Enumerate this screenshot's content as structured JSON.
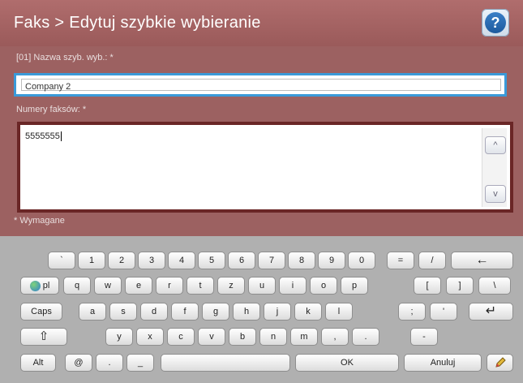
{
  "header": {
    "title": "Faks > Edytuj szybkie wybieranie",
    "help_icon": "question-mark-icon",
    "help_label": "?"
  },
  "form": {
    "name_label": "[01] Nazwa szyb. wyb.: *",
    "name_value": "Company 2",
    "fax_label": "Numery faksów: *",
    "fax_value": "5555555",
    "required_note": "* Wymagane",
    "scroll_up": "^",
    "scroll_down": "v"
  },
  "keyboard": {
    "row1": [
      "`",
      "1",
      "2",
      "3",
      "4",
      "5",
      "6",
      "7",
      "8",
      "9",
      "0",
      "=",
      "/"
    ],
    "backspace": "←",
    "lang": "pl",
    "row2": [
      "q",
      "w",
      "e",
      "r",
      "t",
      "z",
      "u",
      "i",
      "o",
      "p",
      "[",
      "]",
      "\\"
    ],
    "caps": "Caps",
    "row3": [
      "a",
      "s",
      "d",
      "f",
      "g",
      "h",
      "j",
      "k",
      "l",
      ";",
      "'"
    ],
    "enter": "↵",
    "shift": "⇧",
    "row4": [
      "y",
      "x",
      "c",
      "v",
      "b",
      "n",
      "m",
      ",",
      ".",
      "-"
    ],
    "alt": "Alt",
    "at": "@",
    "dot": ".",
    "underscore": "_",
    "space": "",
    "ok": "OK",
    "cancel": "Anuluj",
    "edit_icon": "pencil-icon"
  },
  "colors": {
    "header": "#a66565",
    "content": "#9c6161",
    "focus_border": "#3a9ad9",
    "keyboard_bg": "#b0b0b0"
  }
}
